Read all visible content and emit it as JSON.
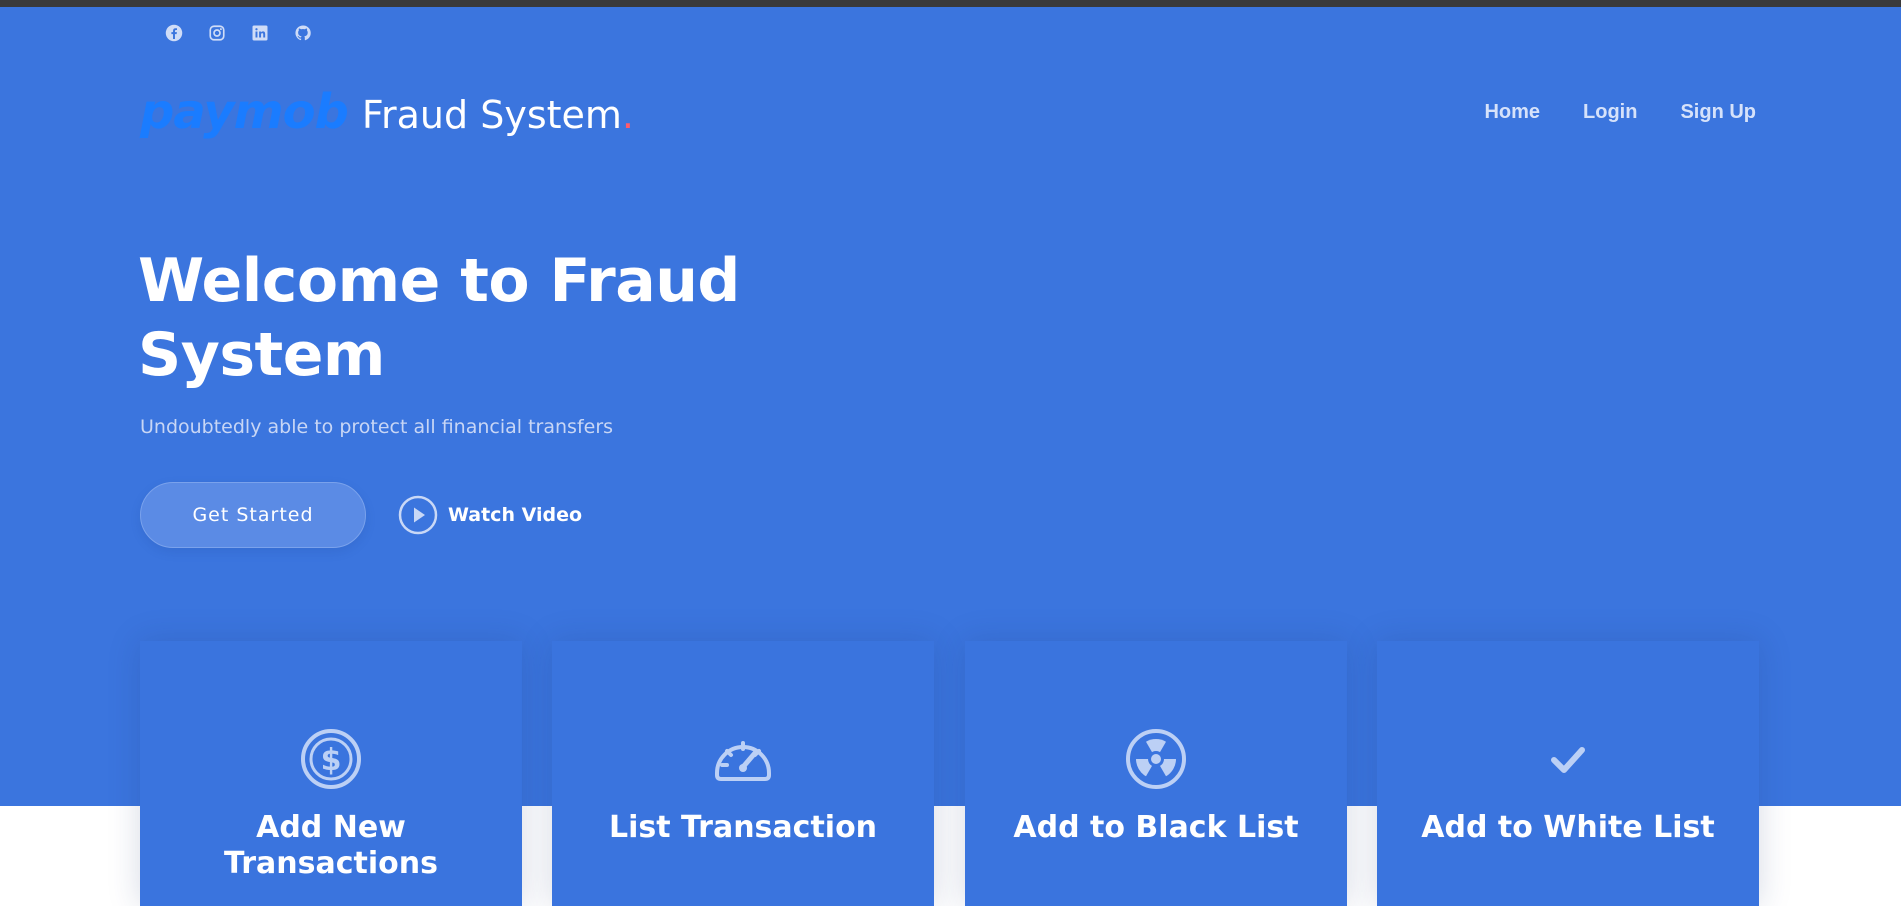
{
  "social": {
    "icons": [
      "facebook-icon",
      "instagram-icon",
      "linkedin-icon",
      "github-icon"
    ]
  },
  "brand": {
    "logo": "paymob",
    "title": "Fraud System",
    "dot": ".",
    "logo_color": "#1a7cff",
    "dot_color": "#ff5b6b"
  },
  "nav": {
    "items": [
      "Home",
      "Login",
      "Sign Up"
    ]
  },
  "hero": {
    "headline": "Welcome to Fraud System",
    "subtitle": "Undoubtedly able to protect all financial transfers",
    "get_started": "Get Started",
    "watch_video": "Watch Video",
    "background": "#3b75de"
  },
  "cards": [
    {
      "icon": "dollar-coin-icon",
      "title": "Add New Transactions"
    },
    {
      "icon": "speedometer-icon",
      "title": "List Transaction"
    },
    {
      "icon": "radiation-icon",
      "title": "Add to Black List"
    },
    {
      "icon": "check-icon",
      "title": "Add to White List"
    }
  ]
}
